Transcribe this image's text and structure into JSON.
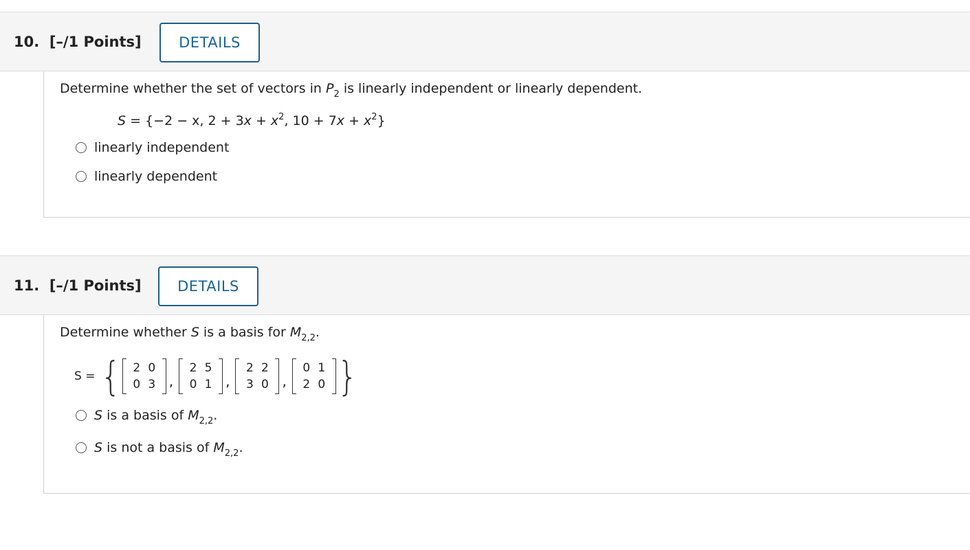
{
  "questions": [
    {
      "number": "10.",
      "points": "[–/1 Points]",
      "details_label": "DETAILS",
      "prompt_text": "Determine whether the set of vectors in",
      "prompt_space": "P",
      "prompt_space_sub": "2",
      "prompt_tail": "is linearly independent or linearly dependent.",
      "set_expression": {
        "lhs": "S",
        "eq": " = {−2 − x, 2 + 3",
        "v1": "x",
        "p1": " + ",
        "v2": "x",
        "s2": "2",
        "p2": ", 10 + 7",
        "v3": "x",
        "p3": " + ",
        "v4": "x",
        "s4": "2",
        "end": "}"
      },
      "options": [
        "linearly independent",
        "linearly dependent"
      ]
    },
    {
      "number": "11.",
      "points": "[–/1 Points]",
      "details_label": "DETAILS",
      "prompt_text": "Determine whether",
      "prompt_var": "S",
      "prompt_mid": "is a basis for",
      "prompt_space": "M",
      "prompt_space_sub": "2,2",
      "prompt_end": ".",
      "set_lhs": "S =",
      "matrices": [
        [
          [
            "2",
            "0"
          ],
          [
            "0",
            "3"
          ]
        ],
        [
          [
            "2",
            "5"
          ],
          [
            "0",
            "1"
          ]
        ],
        [
          [
            "2",
            "2"
          ],
          [
            "3",
            "0"
          ]
        ],
        [
          [
            "0",
            "1"
          ],
          [
            "2",
            "0"
          ]
        ]
      ],
      "options": [
        {
          "var": "S",
          "text": "is a basis of",
          "space": "M",
          "sub": "2,2",
          "end": "."
        },
        {
          "var": "S",
          "text": "is not a basis of",
          "space": "M",
          "sub": "2,2",
          "end": "."
        }
      ]
    }
  ]
}
